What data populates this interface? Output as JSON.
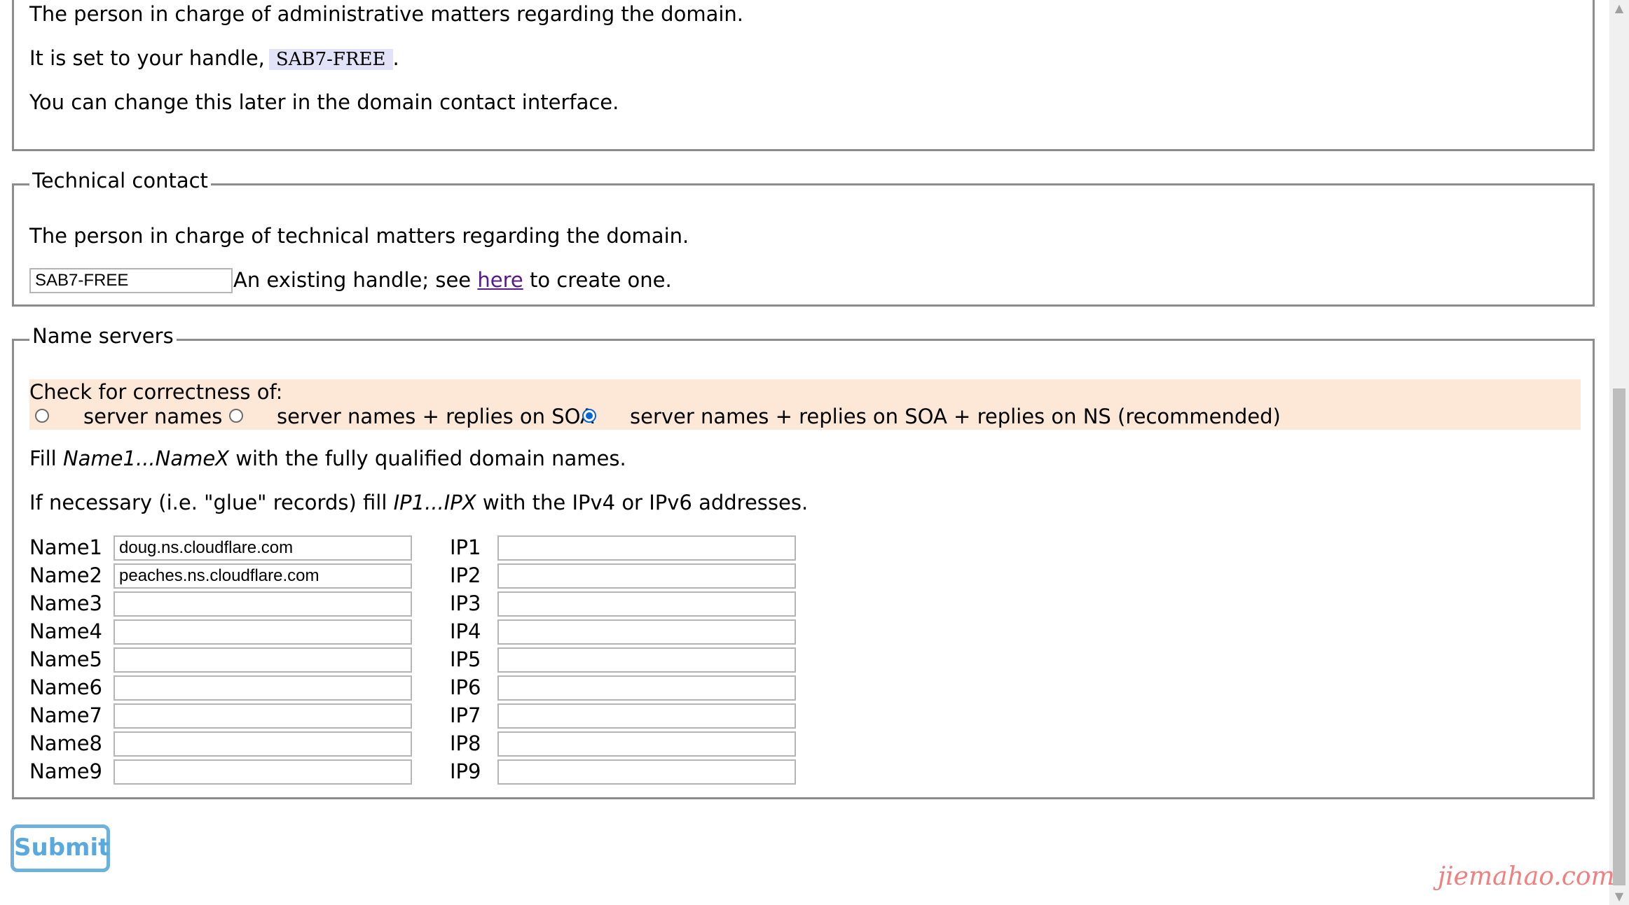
{
  "admin": {
    "line1": "The person in charge of administrative matters regarding the domain.",
    "line2_pre": "It is set to your handle,",
    "handle": "SAB7-FREE",
    "line2_post": ".",
    "line3": "You can change this later in the domain contact interface."
  },
  "tech": {
    "legend": "Technical contact",
    "desc": "The person in charge of technical matters regarding the domain.",
    "input_value": "SAB7-FREE",
    "note_pre": "An existing handle; see",
    "link": "here",
    "note_post": "to create one."
  },
  "ns": {
    "legend": "Name servers",
    "check_title": "Check for correctness of:",
    "options": [
      {
        "label": "server names",
        "checked": false
      },
      {
        "label": "server names + replies on SOA",
        "checked": false
      },
      {
        "label": "server names + replies on SOA + replies on NS (recommended)",
        "checked": true
      }
    ],
    "fill_pre": "Fill",
    "fill_em": "Name1...NameX",
    "fill_post": "with the fully qualified domain names.",
    "glue_pre": "If necessary (i.e. \"glue\" records) fill",
    "glue_em": "IP1...IPX",
    "glue_post": "with the IPv4 or IPv6 addresses.",
    "rows": [
      {
        "name_label": "Name1",
        "name_value": "doug.ns.cloudflare.com",
        "ip_label": "IP1",
        "ip_value": ""
      },
      {
        "name_label": "Name2",
        "name_value": "peaches.ns.cloudflare.com",
        "ip_label": "IP2",
        "ip_value": ""
      },
      {
        "name_label": "Name3",
        "name_value": "",
        "ip_label": "IP3",
        "ip_value": ""
      },
      {
        "name_label": "Name4",
        "name_value": "",
        "ip_label": "IP4",
        "ip_value": ""
      },
      {
        "name_label": "Name5",
        "name_value": "",
        "ip_label": "IP5",
        "ip_value": ""
      },
      {
        "name_label": "Name6",
        "name_value": "",
        "ip_label": "IP6",
        "ip_value": ""
      },
      {
        "name_label": "Name7",
        "name_value": "",
        "ip_label": "IP7",
        "ip_value": ""
      },
      {
        "name_label": "Name8",
        "name_value": "",
        "ip_label": "IP8",
        "ip_value": ""
      },
      {
        "name_label": "Name9",
        "name_value": "",
        "ip_label": "IP9",
        "ip_value": ""
      }
    ]
  },
  "submit_label": "Submit",
  "watermark": "jiemahao.com",
  "colors": {
    "highlight_bg": "#fde8d8",
    "handle_bg": "#e2e2f8",
    "submit_border": "#6eb1df",
    "radio_checked": "#0a63d6",
    "watermark": "#f08080"
  }
}
